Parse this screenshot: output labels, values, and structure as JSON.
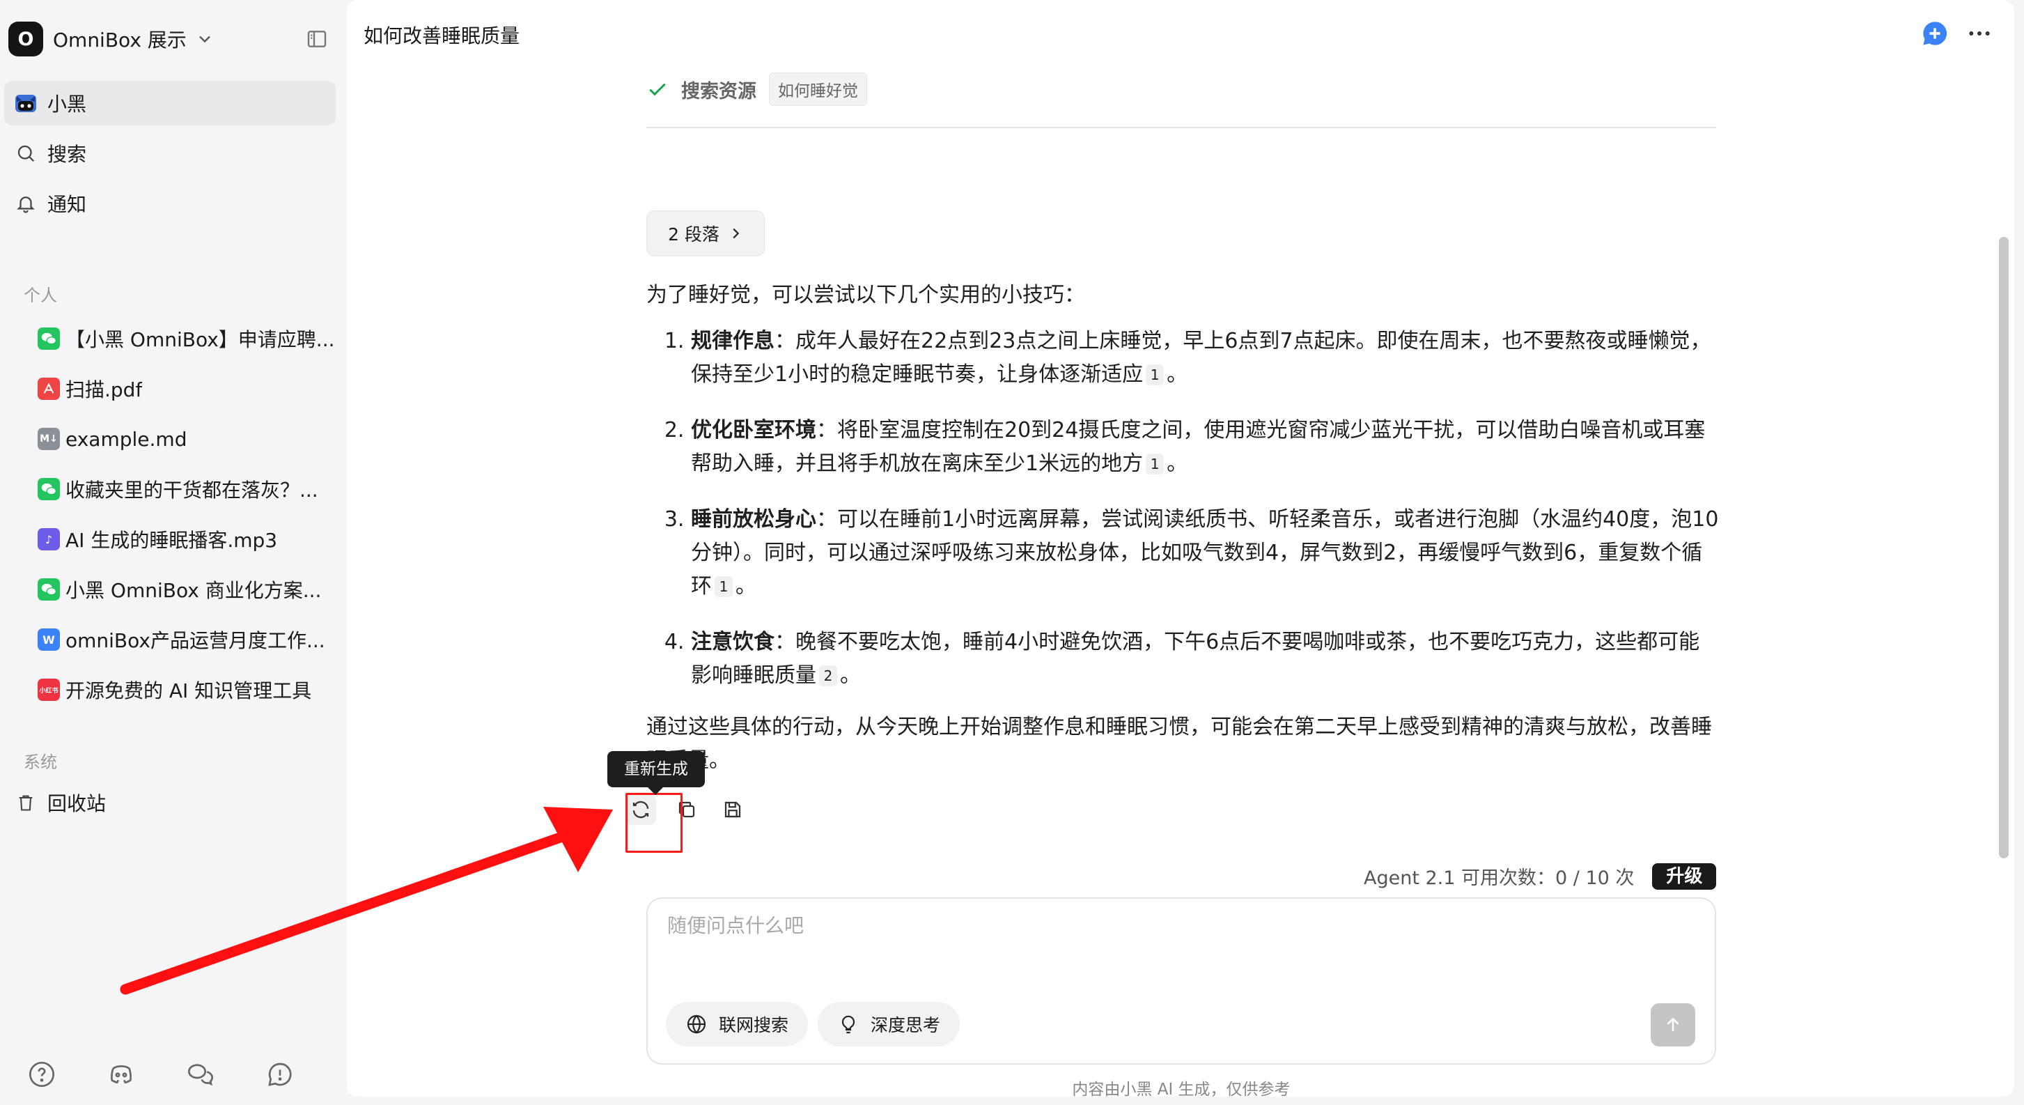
{
  "workspace": {
    "initial": "O",
    "name": "OmniBox 展示"
  },
  "sidebar": {
    "nav": [
      {
        "label": "小黑",
        "icon": "cat-face-icon",
        "active": true
      },
      {
        "label": "搜索",
        "icon": "search-icon",
        "active": false
      },
      {
        "label": "通知",
        "icon": "bell-icon",
        "active": false
      }
    ],
    "personal_label": "个人",
    "docs": [
      {
        "label": "【小黑 OmniBox】申请应聘...",
        "icon": "wechat-icon"
      },
      {
        "label": "扫描.pdf",
        "icon": "pdf-icon"
      },
      {
        "label": "example.md",
        "icon": "markdown-icon"
      },
      {
        "label": "收藏夹里的干货都在落灰？...",
        "icon": "wechat-icon"
      },
      {
        "label": "AI 生成的睡眠播客.mp3",
        "icon": "audio-icon"
      },
      {
        "label": "小黑 OmniBox 商业化方案...",
        "icon": "wechat-icon"
      },
      {
        "label": "omniBox产品运营月度工作...",
        "icon": "word-icon"
      },
      {
        "label": "开源免费的 AI 知识管理工具",
        "icon": "xiaohongshu-icon",
        "badge": "小红书"
      }
    ],
    "system_label": "系统",
    "trash_label": "回收站"
  },
  "header": {
    "title": "如何改善睡眠质量"
  },
  "message": {
    "source_label": "搜索资源",
    "source_tag": "如何睡好觉",
    "paragraph_chip": "2 段落",
    "intro": "为了睡好觉，可以尝试以下几个实用的小技巧：",
    "tips": [
      {
        "title": "规律作息",
        "text": "：成年人最好在22点到23点之间上床睡觉，早上6点到7点起床。即使在周末，也不要熬夜或睡懒觉，保持至少1小时的稳定睡眠节奏，让身体逐渐适应",
        "cite": "1",
        "end": "。"
      },
      {
        "title": "优化卧室环境",
        "text": "：将卧室温度控制在20到24摄氏度之间，使用遮光窗帘减少蓝光干扰，可以借助白噪音机或耳塞帮助入睡，并且将手机放在离床至少1米远的地方",
        "cite": "1",
        "end": "。"
      },
      {
        "title": "睡前放松身心",
        "text": "：可以在睡前1小时远离屏幕，尝试阅读纸质书、听轻柔音乐，或者进行泡脚（水温约40度，泡10分钟）。同时，可以通过深呼吸练习来放松身体，比如吸气数到4，屏气数到2，再缓慢呼气数到6，重复数个循环",
        "cite": "1",
        "end": "。"
      },
      {
        "title": "注意饮食",
        "text": "：晚餐不要吃太饱，睡前4小时避免饮酒，下午6点后不要喝咖啡或茶，也不要吃巧克力，这些都可能影响睡眠质量",
        "cite": "2",
        "end": "。"
      }
    ],
    "closing": "通过这些具体的行动，从今天晚上开始调整作息和睡眠习惯，可能会在第二天早上感受到精神的清爽与放松，改善睡眠质量。",
    "tooltip": "重新生成"
  },
  "quota": {
    "text": "Agent 2.1 可用次数：0 / 10 次",
    "upgrade": "升级"
  },
  "composer": {
    "placeholder": "随便问点什么吧",
    "web_search": "联网搜索",
    "deep_think": "深度思考"
  },
  "disclaimer": "内容由小黑 AI 生成，仅供参考",
  "colors": {
    "accent": "#3b82f6",
    "highlight": "#ff1a1a",
    "sidebar_bg": "#f5f5f7"
  }
}
